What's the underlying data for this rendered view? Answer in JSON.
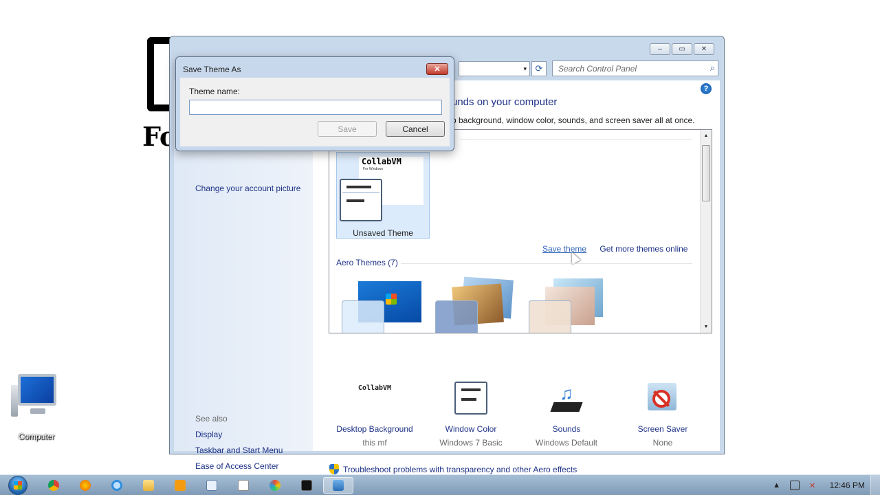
{
  "wallpaper": {
    "text": "Fo"
  },
  "desktop": {
    "icons": [
      {
        "label": "Computer",
        "icon": "computer-icon"
      }
    ]
  },
  "window": {
    "controls": {
      "minimize": "–",
      "maximize": "▭",
      "close": "✕"
    },
    "address": {
      "dropdown_glyph": "▾",
      "refresh_glyph": "⟳"
    },
    "search": {
      "placeholder": "Search Control Panel",
      "icon": "search-icon"
    },
    "help_glyph": "?",
    "sidebar": {
      "account_link": "Change your account picture",
      "see_also_header": "See also",
      "see_also": [
        "Display",
        "Taskbar and Start Menu",
        "Ease of Access Center"
      ]
    },
    "main": {
      "title": "unds on your computer",
      "description": "p background, window color, sounds, and screen saver all at once.",
      "unsaved_theme": {
        "thumb_text": "CollabVM",
        "thumb_sub": "For Windows",
        "label": "Unsaved Theme"
      },
      "links": {
        "save_theme": "Save theme",
        "more_online": "Get more themes online"
      },
      "aero_section": "Aero Themes (7)",
      "bottom": [
        {
          "label": "Desktop Background",
          "sub": "this mf",
          "icon": "desktop-background-icon",
          "thumb_text": "CollabVM"
        },
        {
          "label": "Window Color",
          "sub": "Windows 7 Basic",
          "icon": "window-color-icon"
        },
        {
          "label": "Sounds",
          "sub": "Windows Default",
          "icon": "sounds-icon"
        },
        {
          "label": "Screen Saver",
          "sub": "None",
          "icon": "screen-saver-icon"
        }
      ],
      "troubleshoot": "Troubleshoot problems with transparency and other Aero effects"
    }
  },
  "dialog": {
    "title": "Save Theme As",
    "close_glyph": "✕",
    "label": "Theme name:",
    "input_value": "",
    "save_label": "Save",
    "cancel_label": "Cancel"
  },
  "taskbar": {
    "items": [
      "chrome-icon",
      "firefox-icon",
      "internet-explorer-icon",
      "file-explorer-icon",
      "media-player-icon",
      "notepad-icon",
      "document-icon",
      "paint-icon",
      "command-prompt-icon",
      "control-panel-icon"
    ],
    "tray": {
      "expand_glyph": "▲",
      "clock": "12:46 PM"
    }
  },
  "colors": {
    "link": "#1e3287",
    "window_frame": "#c9d9ec",
    "taskbar": "#8fa9c4"
  }
}
